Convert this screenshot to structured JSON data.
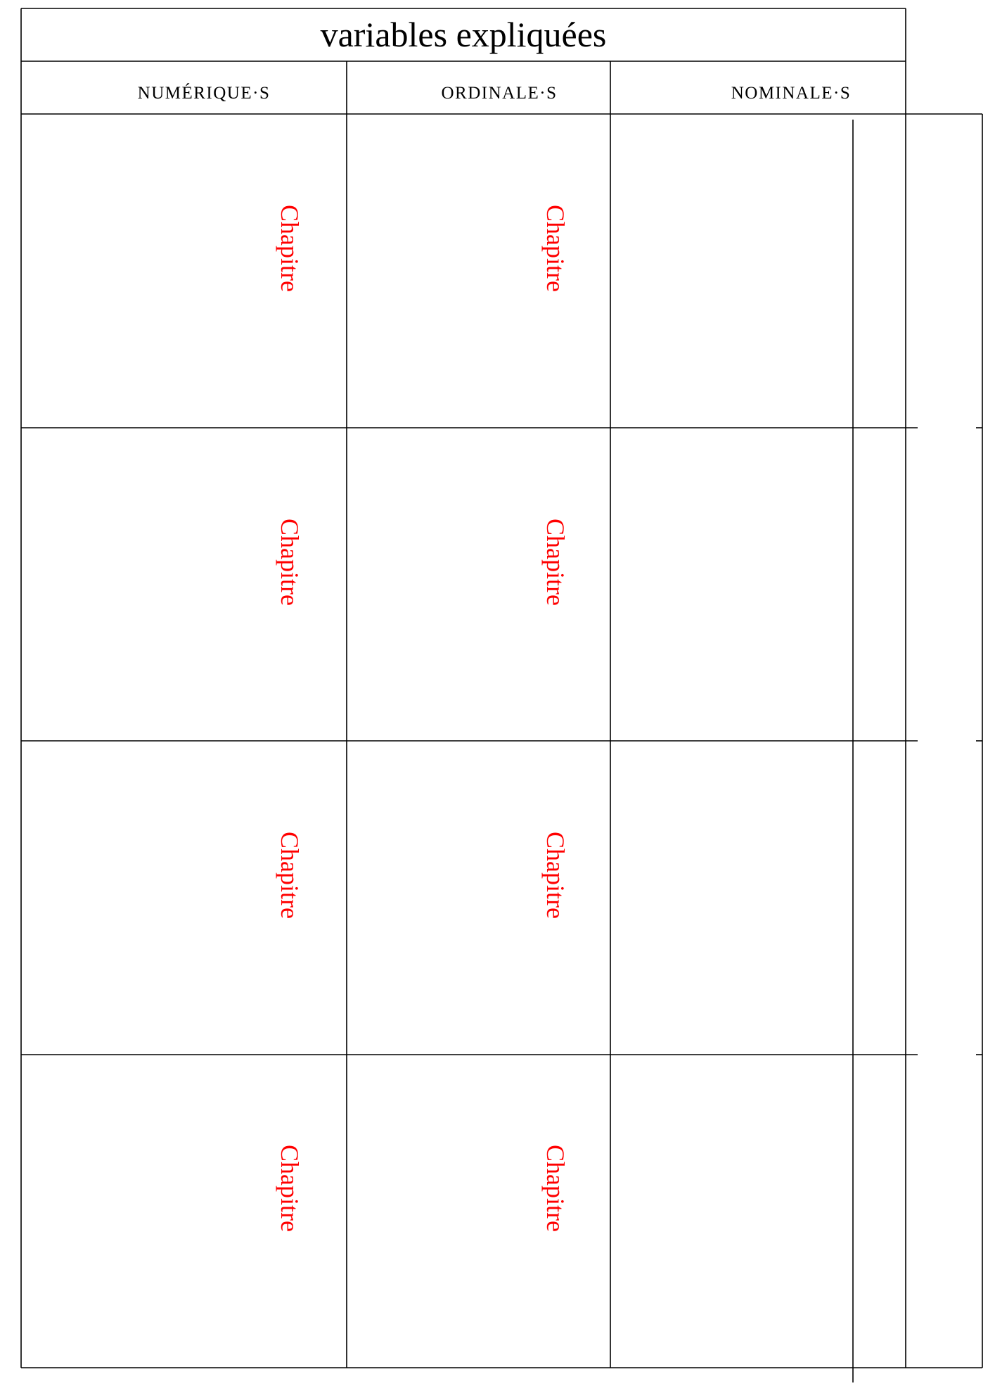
{
  "table": {
    "title": "variables expliquées",
    "columns": [
      "NUMÉRIQUE·S",
      "ORDINALE·S",
      "NOMINALE·S"
    ],
    "rows": [
      [
        "Chapitre",
        "Chapitre",
        ""
      ],
      [
        "Chapitre",
        "Chapitre",
        ""
      ],
      [
        "Chapitre",
        "Chapitre",
        ""
      ],
      [
        "Chapitre",
        "Chapitre",
        ""
      ]
    ]
  },
  "colors": {
    "chapter_text": "#ff0000",
    "grid": "#000000"
  }
}
